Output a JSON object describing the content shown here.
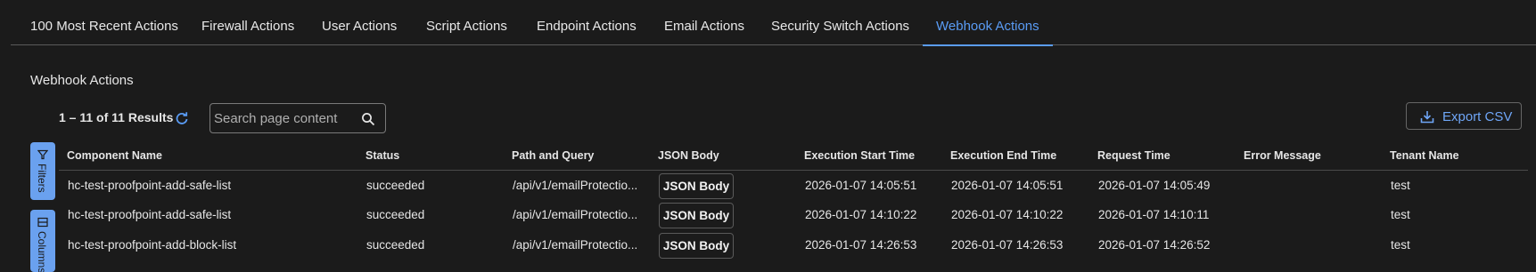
{
  "tabs": [
    {
      "label": "100 Most Recent Actions"
    },
    {
      "label": "Firewall Actions"
    },
    {
      "label": "User Actions"
    },
    {
      "label": "Script Actions"
    },
    {
      "label": "Endpoint Actions"
    },
    {
      "label": "Email Actions"
    },
    {
      "label": "Security Switch Actions"
    },
    {
      "label": "Webhook Actions"
    }
  ],
  "section_title": "Webhook Actions",
  "results_text": "1 – 11 of 11 Results",
  "search": {
    "placeholder": "Search page content"
  },
  "export_label": "Export CSV",
  "side_buttons": {
    "filters": "Filters",
    "columns": "Columns"
  },
  "columns": [
    "Component Name",
    "Status",
    "Path and Query",
    "JSON Body",
    "Execution Start Time",
    "Execution End Time",
    "Request Time",
    "Error Message",
    "Tenant Name"
  ],
  "rows": [
    {
      "component": "hc-test-proofpoint-add-safe-list",
      "status": "succeeded",
      "path": "/api/v1/emailProtectio...",
      "json": "JSON Body",
      "start": "2026-01-07 14:05:51",
      "end": "2026-01-07 14:05:51",
      "request": "2026-01-07 14:05:49",
      "error": "",
      "tenant": "test"
    },
    {
      "component": "hc-test-proofpoint-add-safe-list",
      "status": "succeeded",
      "path": "/api/v1/emailProtectio...",
      "json": "JSON Body",
      "start": "2026-01-07 14:10:22",
      "end": "2026-01-07 14:10:22",
      "request": "2026-01-07 14:10:11",
      "error": "",
      "tenant": "test"
    },
    {
      "component": "hc-test-proofpoint-add-block-list",
      "status": "succeeded",
      "path": "/api/v1/emailProtectio...",
      "json": "JSON Body",
      "start": "2026-01-07 14:26:53",
      "end": "2026-01-07 14:26:53",
      "request": "2026-01-07 14:26:52",
      "error": "",
      "tenant": "test"
    }
  ],
  "accent_color": "#5a9cf5",
  "icons": {
    "refresh": "refresh-icon",
    "search": "search-icon",
    "export": "download-icon",
    "filter": "filter-icon",
    "columns": "columns-icon"
  }
}
